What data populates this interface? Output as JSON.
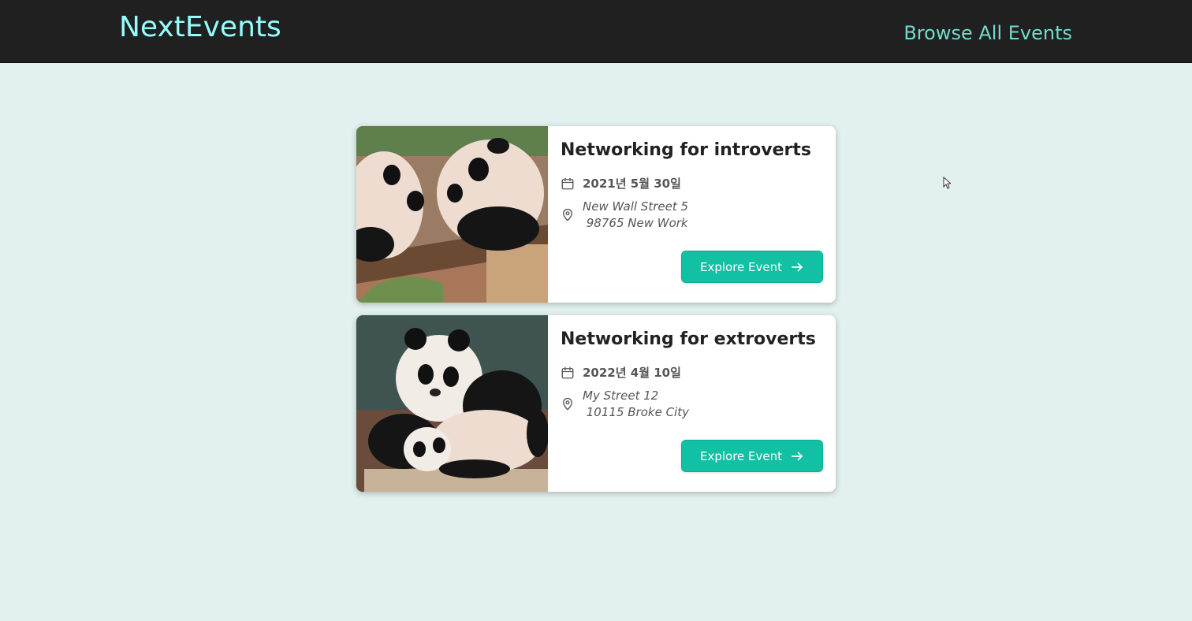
{
  "header": {
    "logo": "NextEvents",
    "nav_link": "Browse All Events"
  },
  "events": [
    {
      "title": "Networking for introverts",
      "date": "2021년 5월 30일",
      "address": "New Wall Street 5\n 98765 New Work",
      "button_label": "Explore Event",
      "image_subject": "two panda cubs on log"
    },
    {
      "title": "Networking for extroverts",
      "date": "2022년 4월 10일",
      "address": "My Street 12\n 10115 Broke City",
      "button_label": "Explore Event",
      "image_subject": "two pandas playing"
    }
  ],
  "icons": {
    "date": "calendar-icon",
    "address": "map-pin-icon",
    "button": "arrow-right-icon"
  },
  "colors": {
    "header_bg": "#202020",
    "logo": "#94fdfd",
    "nav_link": "#74dacc",
    "page_bg": "#e2f1ef",
    "button_bg": "#12c0a3"
  }
}
